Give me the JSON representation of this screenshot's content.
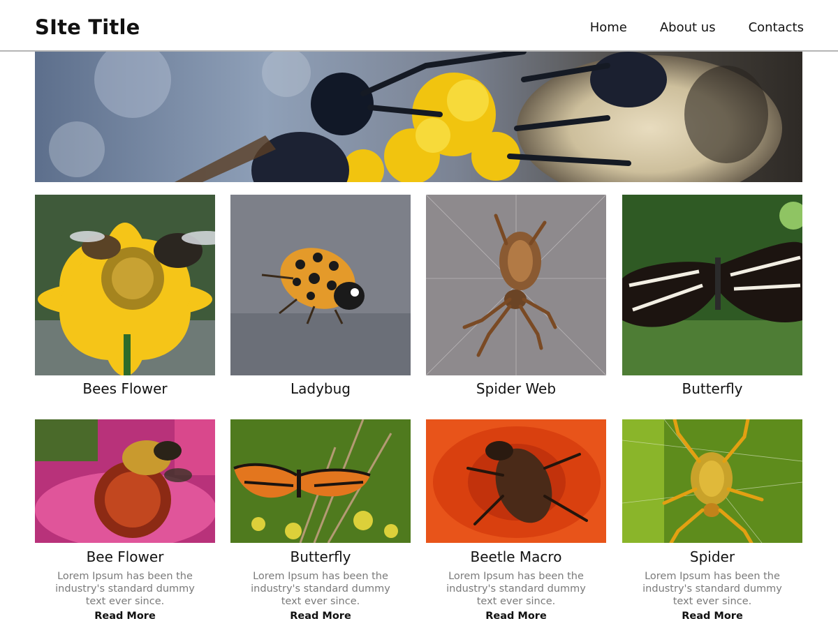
{
  "header": {
    "site_title": "SIte Title",
    "nav": [
      "Home",
      "About us",
      "Contacts"
    ]
  },
  "gallery_row1": [
    {
      "title": "Bees Flower"
    },
    {
      "title": "Ladybug"
    },
    {
      "title": "Spider Web"
    },
    {
      "title": "Butterfly"
    }
  ],
  "gallery_row2": [
    {
      "title": "Bee Flower",
      "description": "Lorem Ipsum has been the industry's standard dummy text ever since.",
      "link": "Read More"
    },
    {
      "title": "Butterfly",
      "description": "Lorem Ipsum has been the industry's standard dummy text ever since.",
      "link": "Read More"
    },
    {
      "title": "Beetle Macro",
      "description": "Lorem Ipsum has been the industry's standard dummy text ever since.",
      "link": "Read More"
    },
    {
      "title": "Spider",
      "description": "Lorem Ipsum has been the industry's standard dummy text ever since.",
      "link": "Read More"
    }
  ]
}
